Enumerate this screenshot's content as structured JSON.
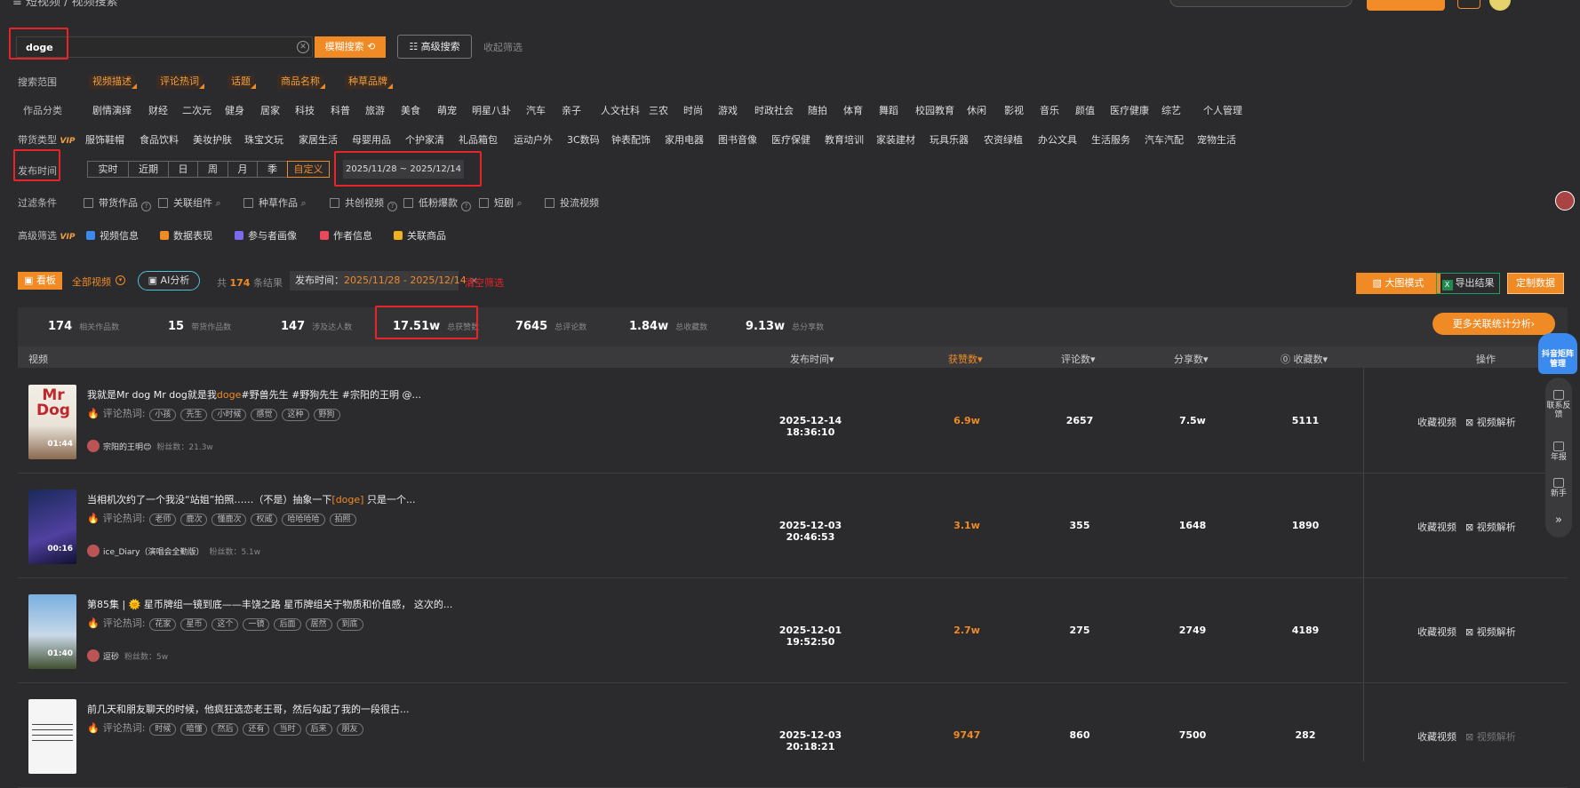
{
  "header": {
    "crumb": "≡ 短视频 / 视频搜索"
  },
  "search": {
    "value": "doge",
    "fuzzy_label": "模糊搜索 ⟲",
    "advanced_label": "高级搜索",
    "fold_label": "收起筛选"
  },
  "scope": {
    "label": "搜索范围",
    "tags": [
      "视频描述",
      "评论热词",
      "话题",
      "商品名称",
      "种草品牌"
    ]
  },
  "categories": {
    "label": "作品分类",
    "items": [
      "剧情演绎",
      "财经",
      "二次元",
      "健身",
      "居家",
      "科技",
      "科普",
      "旅游",
      "美食",
      "萌宠",
      "明星八卦",
      "汽车",
      "亲子",
      "人文社科",
      "三农",
      "时尚",
      "游戏",
      "时政社会",
      "随拍",
      "体育",
      "舞蹈",
      "校园教育",
      "休闲",
      "影视",
      "音乐",
      "颜值",
      "医疗健康",
      "综艺",
      "个人管理"
    ]
  },
  "goods": {
    "label": "带货类型",
    "vip": "VIP",
    "items": [
      "服饰鞋帽",
      "食品饮料",
      "美妆护肤",
      "珠宝文玩",
      "家居生活",
      "母婴用品",
      "个护家清",
      "礼品箱包",
      "运动户外",
      "3C数码",
      "钟表配饰",
      "家用电器",
      "图书音像",
      "医疗保健",
      "教育培训",
      "家装建材",
      "玩具乐器",
      "农资绿植",
      "办公文具",
      "生活服务",
      "汽车汽配",
      "宠物生活"
    ]
  },
  "publish": {
    "label": "发布时间",
    "segments": [
      "实时",
      "近期",
      "日",
      "周",
      "月",
      "季",
      "自定义"
    ],
    "range": "2025/11/28 ~ 2025/12/14"
  },
  "filters": {
    "label": "过滤条件",
    "items": [
      "带货作品",
      "关联组件",
      "种草作品",
      "共创视频",
      "低粉爆款",
      "短剧",
      "投流视频"
    ]
  },
  "advanced": {
    "label": "高级筛选",
    "vip": "VIP",
    "items": [
      "视频信息",
      "数据表现",
      "参与者画像",
      "作者信息",
      "关联商品"
    ]
  },
  "toolbar": {
    "kanban": "看板",
    "all_videos": "全部视频",
    "ai": "AI分析",
    "total_prefix": "共",
    "total_count": "174",
    "total_suffix": "条结果",
    "tag_label": "发布时间：",
    "tag_value": "2025/11/28 - 2025/12/14",
    "tag_close": "×",
    "clear": "清空筛选",
    "big_mode": "大图模式",
    "export": "导出结果",
    "custom": "定制数据"
  },
  "stats": [
    {
      "n": "174",
      "l": "相关作品数"
    },
    {
      "n": "15",
      "l": "带货作品数"
    },
    {
      "n": "147",
      "l": "涉及达人数"
    },
    {
      "n": "17.51w",
      "l": "总获赞数"
    },
    {
      "n": "7645",
      "l": "总评论数"
    },
    {
      "n": "1.84w",
      "l": "总收藏数"
    },
    {
      "n": "9.13w",
      "l": "总分享数"
    }
  ],
  "more_analysis": "更多关联统计分析›",
  "columns": {
    "video": "视频",
    "time": "发布时间▾",
    "likes": "获赞数▾",
    "comments": "评论数▾",
    "shares": "分享数▾",
    "favs": "⓪ 收藏数▾",
    "ops": "操作"
  },
  "rows": [
    {
      "title_pre": "我就是Mr dog Mr dog就是我",
      "title_hl": "doge",
      "title_post": "#野兽先生 #野狗先生 #宗阳的王明 @...",
      "hot_label": "评论热词:",
      "tags": [
        "小孩",
        "先生",
        "小时候",
        "感觉",
        "这种",
        "野狗"
      ],
      "author": "宗阳的王明😊",
      "fans": "粉丝数：21.3w",
      "duration": "01:44",
      "time": "2025-12-14 18:36:10",
      "likes": "6.9w",
      "comments": "2657",
      "shares": "7.5w",
      "favs": "5111",
      "op1": "收藏视频",
      "op2": "视频解析",
      "thumb_text": "Mr Dog"
    },
    {
      "title_pre": "当相机次约了一个我没“站姐”拍照……（不是）抽象一下",
      "title_hl": "[doge]",
      "title_post": " 只是一个...",
      "hot_label": "评论热词:",
      "tags": [
        "老师",
        "鹿次",
        "懂鹿次",
        "权威",
        "哈哈哈哈",
        "拍照"
      ],
      "author": "ice_Diary（演唱会全勤版）",
      "fans": "粉丝数：5.1w",
      "duration": "00:16",
      "time": "2025-12-03 20:46:53",
      "likes": "3.1w",
      "comments": "355",
      "shares": "1648",
      "favs": "1890",
      "op1": "收藏视频",
      "op2": "视频解析",
      "thumb_text": ""
    },
    {
      "title_pre": "第85集 | 🌞 星币牌组一镜到底——丰饶之路 星币牌组关于物质和价值感，  这次的...",
      "title_hl": "",
      "title_post": "",
      "hot_label": "评论热词:",
      "tags": [
        "花家",
        "星币",
        "这个",
        "一镜",
        "后面",
        "居然",
        "到底"
      ],
      "author": "逗砂",
      "fans": "粉丝数：5w",
      "duration": "01:40",
      "time": "2025-12-01 19:52:50",
      "likes": "2.7w",
      "comments": "275",
      "shares": "2749",
      "favs": "4189",
      "op1": "收藏视频",
      "op2": "视频解析",
      "thumb_text": ""
    },
    {
      "title_pre": "前几天和朋友聊天的时候，他疯狂选恋老王哥，然后勾起了我的一段很古...",
      "title_hl": "",
      "title_post": "",
      "hot_label": "评论热词:",
      "tags": [
        "时候",
        "暗懂",
        "然后",
        "还有",
        "当时",
        "后来",
        "朋友"
      ],
      "author": "",
      "fans": "",
      "duration": "",
      "time": "2025-12-03 20:18:21",
      "likes": "9747",
      "comments": "860",
      "shares": "7500",
      "favs": "282",
      "op1": "收藏视频",
      "op2": "视频解析",
      "thumb_text": ""
    }
  ],
  "side": {
    "douyin": "抖音矩阵管理",
    "items": [
      "联系反馈",
      "年报",
      "新手"
    ],
    "expand": "»"
  }
}
